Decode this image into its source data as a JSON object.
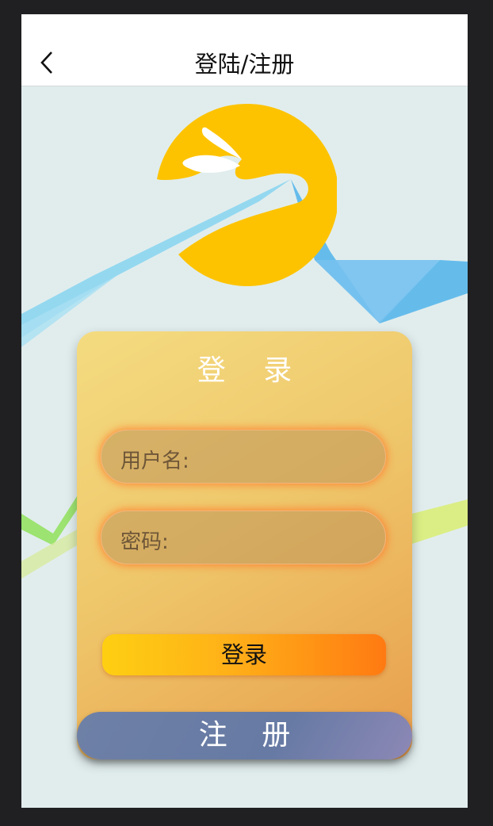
{
  "header": {
    "title": "登陆/注册",
    "back_icon": "chevron-left-icon"
  },
  "card": {
    "title": "登 录",
    "username": {
      "label": "用户名:",
      "value": ""
    },
    "password": {
      "label": "密码:",
      "value": ""
    },
    "login_label": "登录"
  },
  "register_label": "注 册",
  "colors": {
    "logo": "#fdc300",
    "login_gradient": [
      "#fecf12",
      "#ff7a12"
    ],
    "register": "#6b7ea6",
    "background": "#e1eded"
  }
}
